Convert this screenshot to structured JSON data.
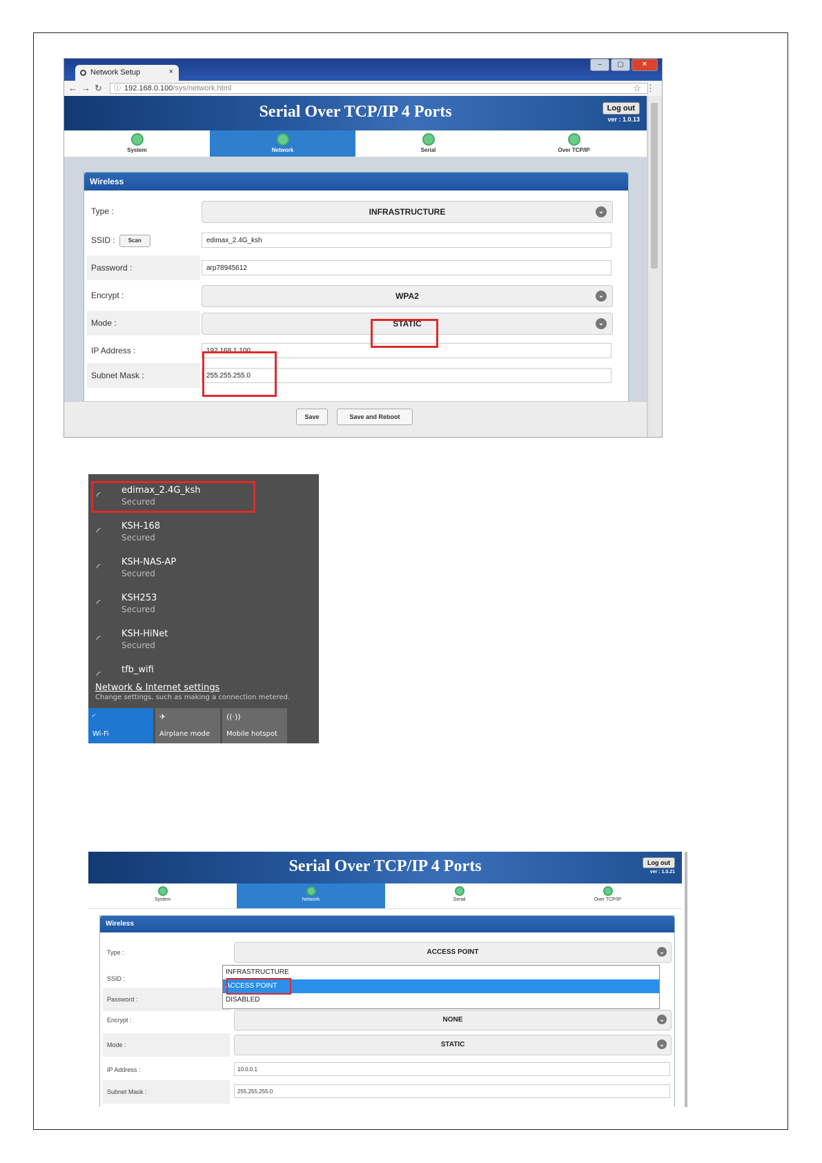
{
  "shot1": {
    "tab_title": "Network Setup",
    "tab_close": "×",
    "url_host": "192.168.0.100",
    "url_path": "/sys/network.html",
    "app_title": "Serial Over TCP/IP 4 Ports",
    "logout_label": "Log out",
    "version": "ver : 1.0.13",
    "tabs": [
      "System",
      "Network",
      "Serial",
      "Over TCP/IP"
    ],
    "panel_title": "Wireless",
    "fields": {
      "type_label": "Type :",
      "type_value": "INFRASTRUCTURE",
      "ssid_label": "SSID :",
      "scan_label": "Scan",
      "ssid_value": "edimax_2.4G_ksh",
      "password_label": "Password :",
      "password_value": "arp78945612",
      "encrypt_label": "Encrypt :",
      "encrypt_value": "WPA2",
      "mode_label": "Mode :",
      "mode_value": "STATIC",
      "ip_label": "IP Address :",
      "ip_value": "192.168.1.100",
      "mask_label": "Subnet Mask :",
      "mask_value": "255.255.255.0"
    },
    "save_label": "Save",
    "save_reboot_label": "Save and Reboot"
  },
  "shot2": {
    "networks": [
      {
        "name": "edimax_2.4G_ksh",
        "status": "Secured"
      },
      {
        "name": "KSH-168",
        "status": "Secured"
      },
      {
        "name": "KSH-NAS-AP",
        "status": "Secured"
      },
      {
        "name": "KSH253",
        "status": "Secured"
      },
      {
        "name": "KSH-HiNet",
        "status": "Secured"
      },
      {
        "name": "tfb_wifi",
        "status": ""
      }
    ],
    "settings_link": "Network & Internet settings",
    "settings_sub": "Change settings, such as making a connection metered.",
    "quick": [
      "Wi-Fi",
      "Airplane mode",
      "Mobile hotspot"
    ],
    "colors": {
      "wifi_active": "#1e78d2",
      "tile": "#6a6a6a"
    }
  },
  "shot3": {
    "app_title": "Serial Over TCP/IP 4 Ports",
    "logout_label": "Log out",
    "version": "ver : 1.0.21",
    "tabs": [
      "System",
      "Network",
      "Serial",
      "Over TCP/IP"
    ],
    "panel_title": "Wireless",
    "type_label": "Type :",
    "type_value": "ACCESS POINT",
    "ssid_label": "SSID :",
    "password_label": "Password :",
    "dropdown_options": [
      "INFRASTRUCTURE",
      "ACCESS POINT",
      "DISABLED"
    ],
    "encrypt_label": "Encrypt :",
    "encrypt_value": "NONE",
    "mode_label": "Mode :",
    "mode_value": "STATIC",
    "ip_label": "IP Address :",
    "ip_value": "10.0.0.1",
    "mask_label": "Subnet Mask :",
    "mask_value": "255.255.255.0"
  },
  "colors": {
    "header_blue": "#1e4f92",
    "tab_active": "#2f7fcf",
    "highlight_red": "#e02a2a"
  }
}
